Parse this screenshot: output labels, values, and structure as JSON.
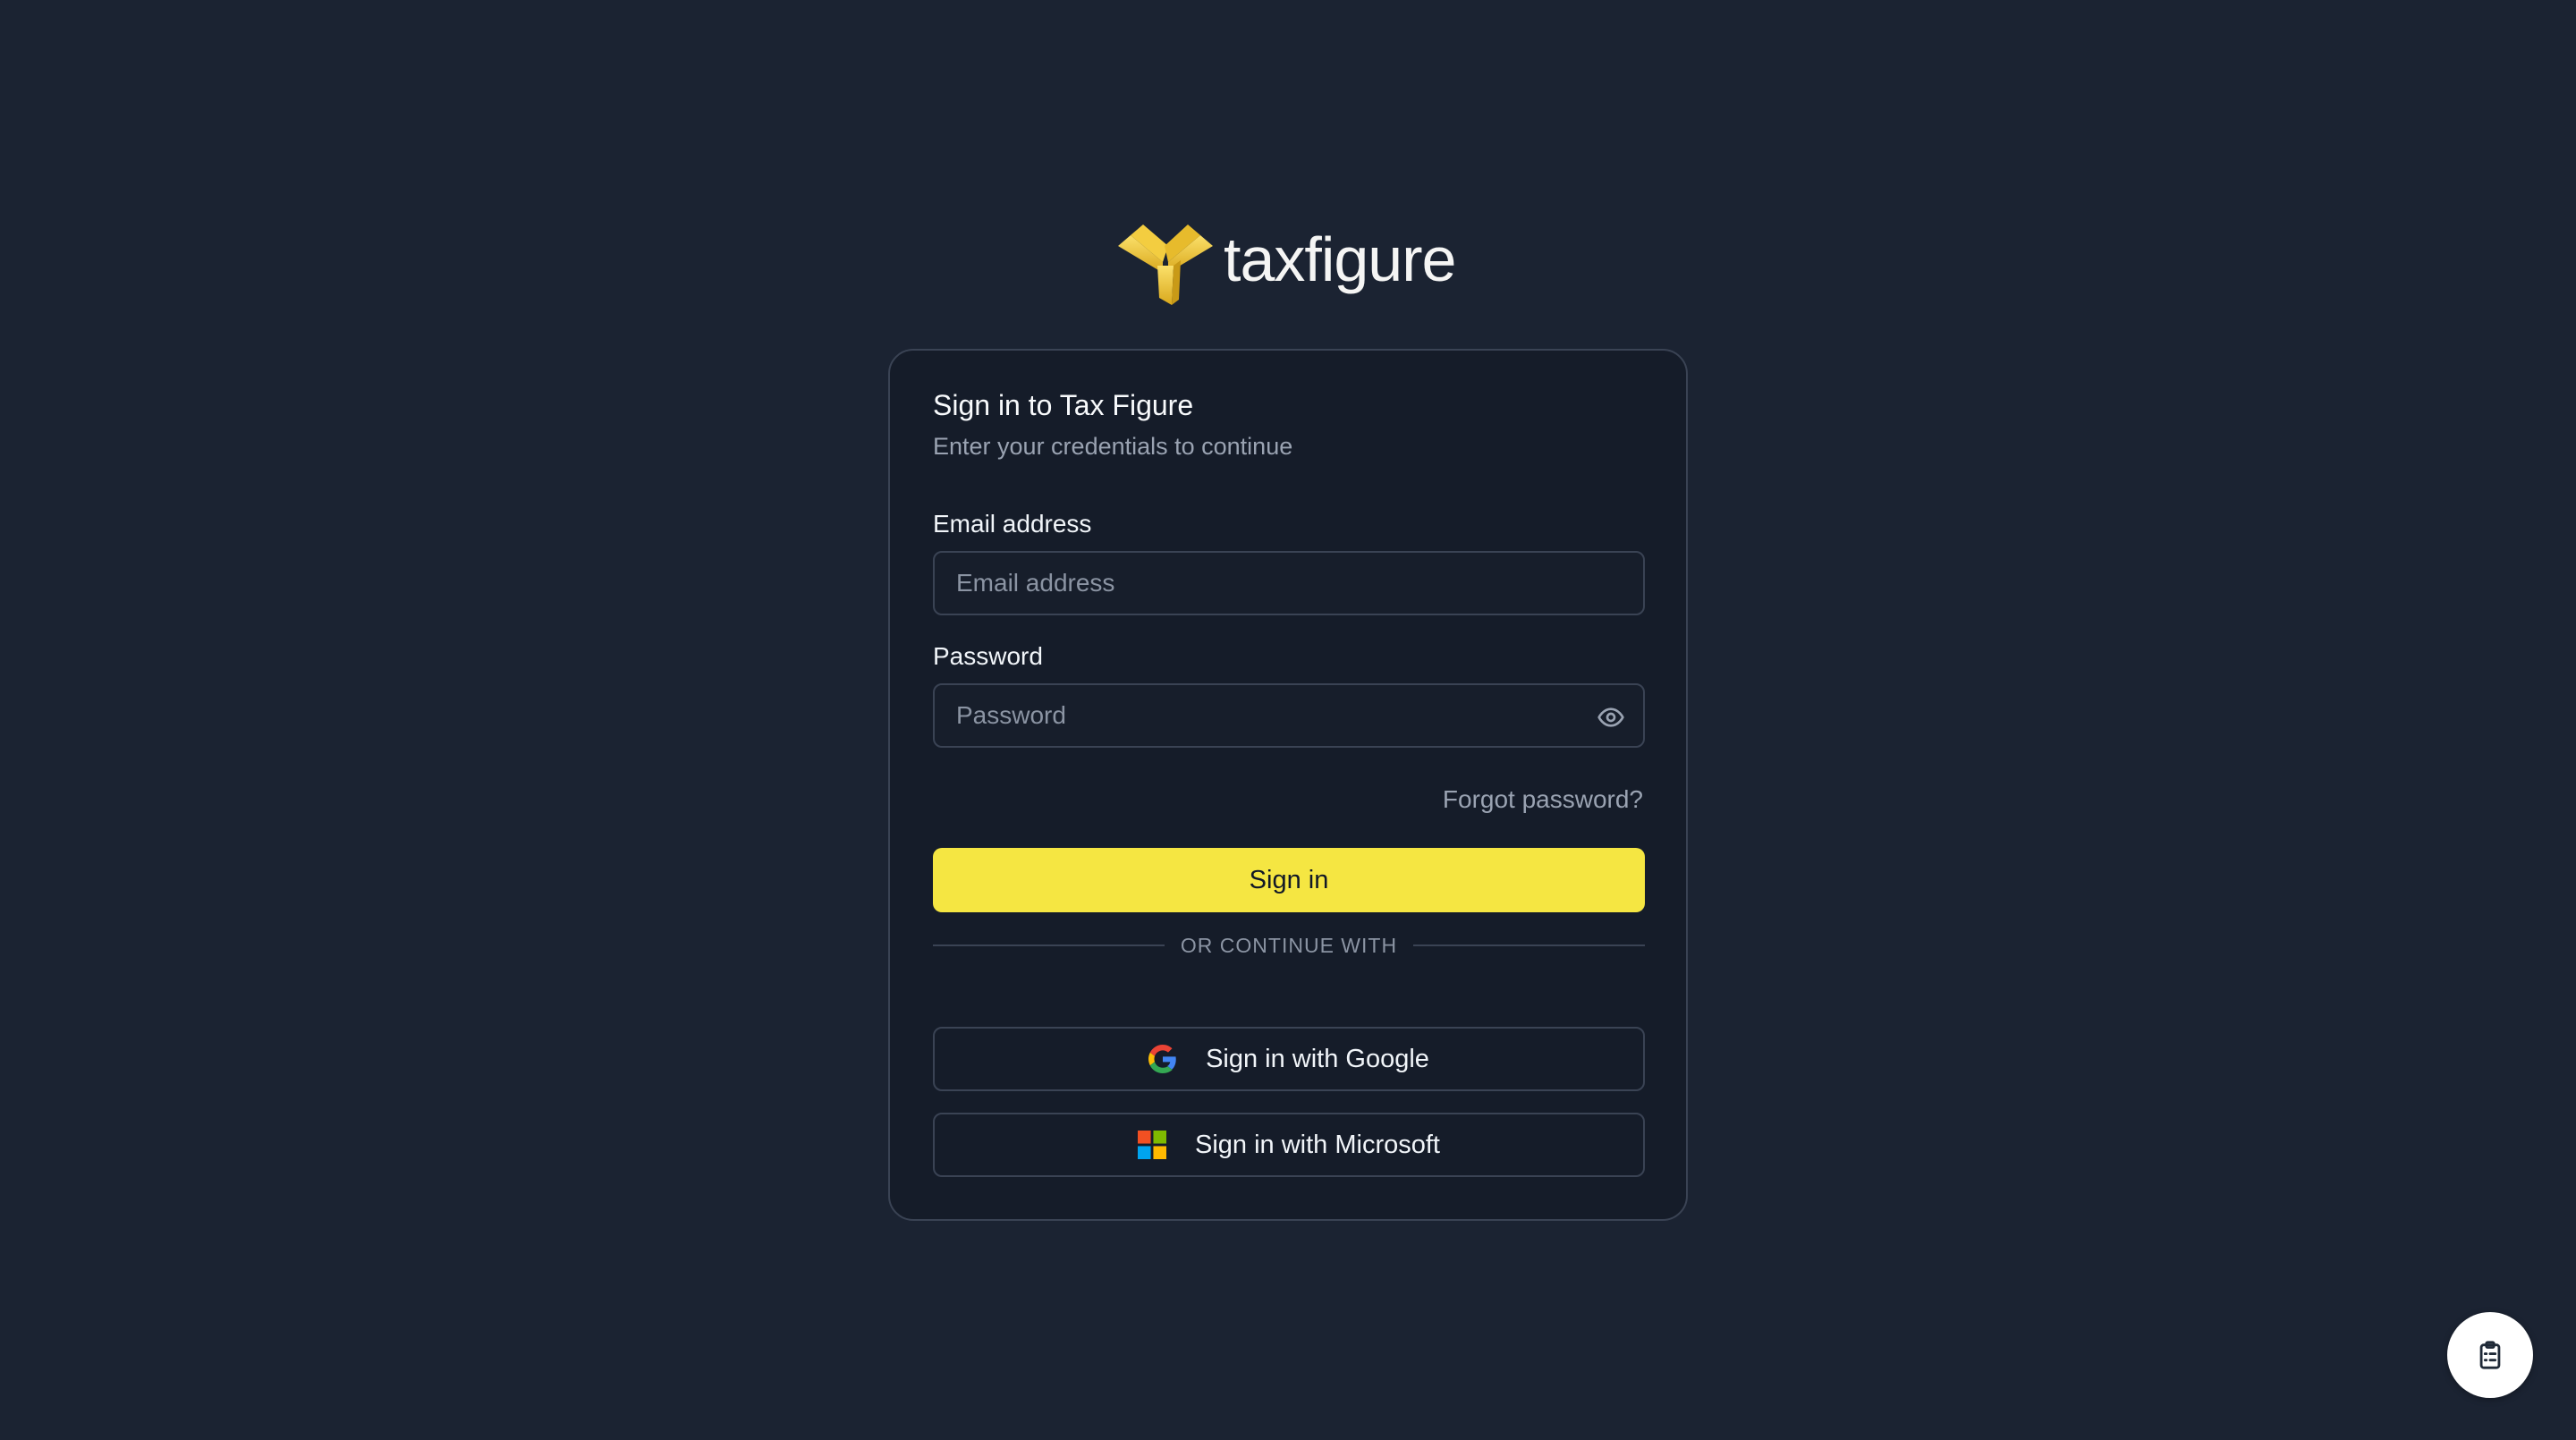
{
  "brand": {
    "name": "taxfigure",
    "accent_color": "#f5e642"
  },
  "card": {
    "title": "Sign in to Tax Figure",
    "subtitle": "Enter your credentials to continue"
  },
  "email": {
    "label": "Email address",
    "placeholder": "Email address",
    "value": ""
  },
  "password": {
    "label": "Password",
    "placeholder": "Password",
    "value": "",
    "toggle_icon": "eye-icon"
  },
  "forgot_password": "Forgot password?",
  "sign_in_label": "Sign in",
  "divider_text": "OR CONTINUE WITH",
  "social": {
    "google_label": "Sign in with Google",
    "google_icon": "google-icon",
    "microsoft_label": "Sign in with Microsoft",
    "microsoft_icon": "microsoft-icon"
  },
  "fab": {
    "icon": "clipboard-icon"
  }
}
